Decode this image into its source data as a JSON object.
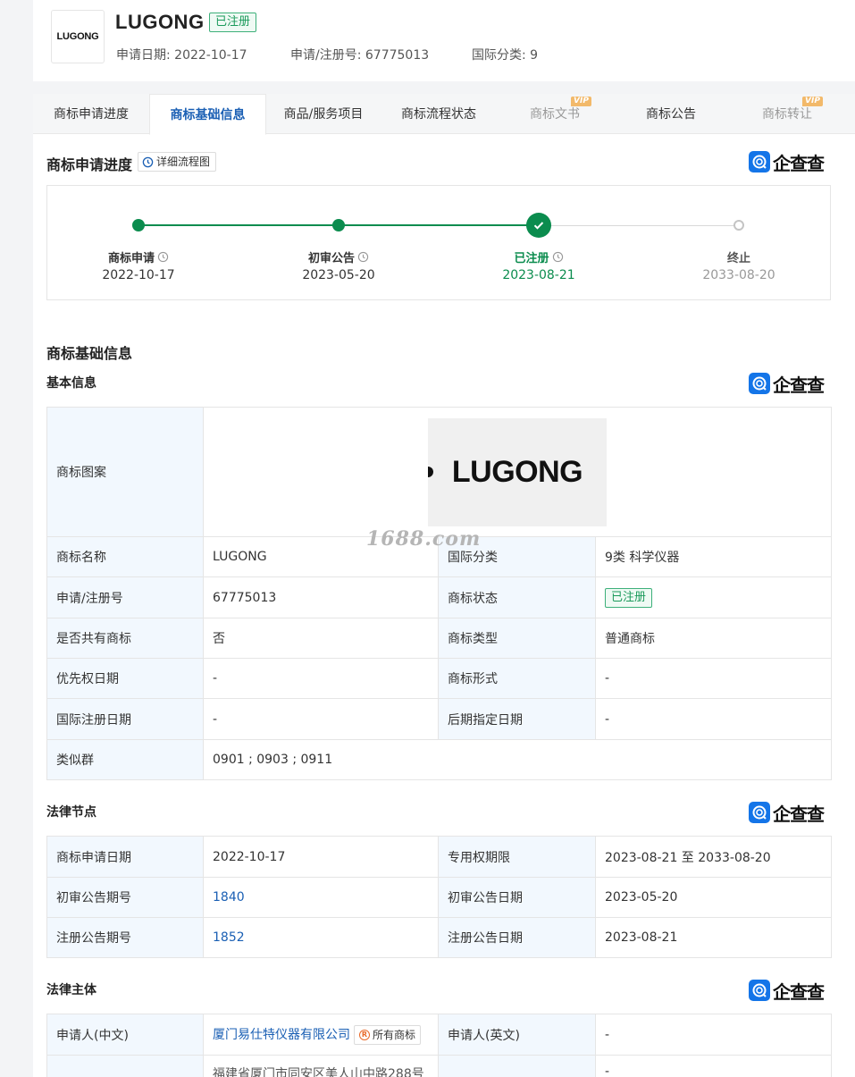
{
  "header": {
    "logo_text": "LUGONG",
    "name": "LUGONG",
    "status_tag": "已注册",
    "apply_date": "申请日期: 2022-10-17",
    "reg_no": "申请/注册号: 67775013",
    "intl_class": "国际分类: 9"
  },
  "tabs": [
    {
      "label": "商标申请进度",
      "active": false,
      "vip": false
    },
    {
      "label": "商标基础信息",
      "active": true,
      "vip": false
    },
    {
      "label": "商品/服务项目",
      "active": false,
      "vip": false
    },
    {
      "label": "商标流程状态",
      "active": false,
      "vip": false
    },
    {
      "label": "商标文书",
      "active": false,
      "vip": true
    },
    {
      "label": "商标公告",
      "active": false,
      "vip": false
    },
    {
      "label": "商标转让",
      "active": false,
      "vip": true
    }
  ],
  "vip_label": "VIP",
  "brand_logo_text": "企查查",
  "colors": {
    "accent_blue": "#1a5fb4",
    "success_green": "#0b8c4e",
    "label_bg": "#f2f8fe",
    "qcc_blue": "#1475e8"
  },
  "progress_section": {
    "title": "商标申请进度",
    "flow_button": "详细流程图",
    "steps": [
      {
        "label": "商标申请",
        "date": "2022-10-17",
        "state": "done"
      },
      {
        "label": "初审公告",
        "date": "2023-05-20",
        "state": "done"
      },
      {
        "label": "已注册",
        "date": "2023-08-21",
        "state": "current"
      },
      {
        "label": "终止",
        "date": "2033-08-20",
        "state": "pending"
      }
    ]
  },
  "basic_section": {
    "title": "商标基础信息",
    "subtitle": "基本信息",
    "image_label": "商标图案",
    "image_text": "LUGONG",
    "rows": [
      {
        "l1": "商标名称",
        "v1": "LUGONG",
        "l2": "国际分类",
        "v2": "9类 科学仪器"
      },
      {
        "l1": "申请/注册号",
        "v1": "67775013",
        "l2": "商标状态",
        "v2": "已注册"
      },
      {
        "l1": "是否共有商标",
        "v1": "否",
        "l2": "商标类型",
        "v2": "普通商标"
      },
      {
        "l1": "优先权日期",
        "v1": "-",
        "l2": "商标形式",
        "v2": "-"
      },
      {
        "l1": "国际注册日期",
        "v1": "-",
        "l2": "后期指定日期",
        "v2": "-"
      }
    ],
    "similar_label": "类似群",
    "similar_value": "0901 ; 0903 ; 0911"
  },
  "legal_nodes": {
    "subtitle": "法律节点",
    "rows": [
      {
        "l1": "商标申请日期",
        "v1": "2022-10-17",
        "l2": "专用权期限",
        "v2": "2023-08-21 至 2033-08-20"
      },
      {
        "l1": "初审公告期号",
        "v1": "1840",
        "l2": "初审公告日期",
        "v2": "2023-05-20"
      },
      {
        "l1": "注册公告期号",
        "v1": "1852",
        "l2": "注册公告日期",
        "v2": "2023-08-21"
      }
    ]
  },
  "legal_subject": {
    "subtitle": "法律主体",
    "applicant_cn_label": "申请人(中文)",
    "applicant_cn": "厦门易仕特仪器有限公司",
    "owner_tag": "所有商标",
    "applicant_en_label": "申请人(英文)",
    "applicant_en": "-",
    "address_partial": "福建省厦门市同安区美人山中路288号",
    "address_en": "-"
  },
  "watermark": "1688.com"
}
